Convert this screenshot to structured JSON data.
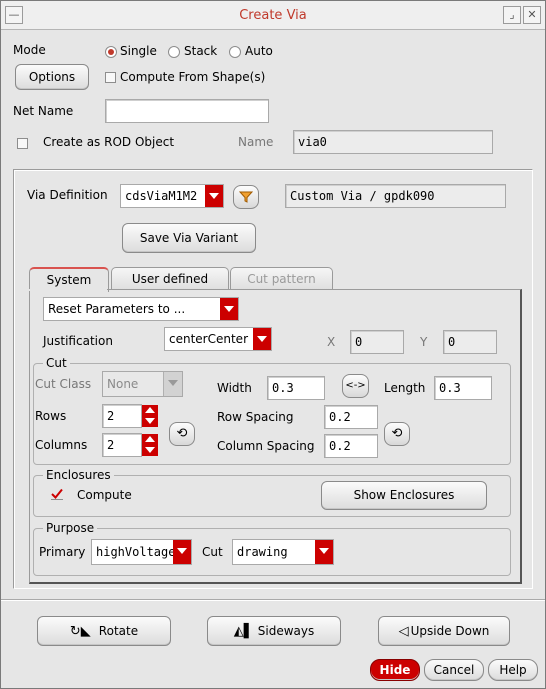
{
  "window": {
    "title": "Create Via"
  },
  "mode": {
    "label": "Mode",
    "options": [
      "Single",
      "Stack",
      "Auto"
    ],
    "selected": "Single"
  },
  "options_button": "Options",
  "compute_from_shapes": "Compute From Shape(s)",
  "net_name": {
    "label": "Net Name",
    "value": ""
  },
  "rod": {
    "label": "Create as ROD Object",
    "name_label": "Name",
    "name_value": "via0"
  },
  "via_definition": {
    "label": "Via Definition",
    "value": "cdsViaM1M2",
    "info": "Custom Via / gpdk090"
  },
  "save_variant_button": "Save Via Variant",
  "tabs": [
    {
      "label": "System",
      "active": true
    },
    {
      "label": "User defined",
      "active": false
    },
    {
      "label": "Cut pattern",
      "disabled": true
    }
  ],
  "reset_params": "Reset Parameters to ...",
  "justification": {
    "label": "Justification",
    "value": "centerCenter"
  },
  "offset": {
    "x_label": "X",
    "x_value": "0",
    "y_label": "Y",
    "y_value": "0"
  },
  "cut": {
    "title": "Cut",
    "class_label": "Cut Class",
    "class_value": "None",
    "width_label": "Width",
    "width_value": "0.3",
    "link_symbol": "<->",
    "length_label": "Length",
    "length_value": "0.3",
    "rows_label": "Rows",
    "rows_value": "2",
    "columns_label": "Columns",
    "columns_value": "2",
    "row_spacing_label": "Row Spacing",
    "row_spacing_value": "0.2",
    "column_spacing_label": "Column Spacing",
    "column_spacing_value": "0.2"
  },
  "enclosures": {
    "title": "Enclosures",
    "compute_label": "Compute",
    "show_button": "Show Enclosures"
  },
  "purpose": {
    "title": "Purpose",
    "primary_label": "Primary",
    "primary_value": "highVoltage",
    "cut_label": "Cut",
    "cut_value": "drawing"
  },
  "bottom": {
    "rotate": "Rotate",
    "sideways": "Sideways",
    "upside_down": "Upside Down"
  },
  "footer": {
    "hide": "Hide",
    "cancel": "Cancel",
    "help": "Help"
  },
  "colors": {
    "accent": "#c00000",
    "title": "#c0392b"
  }
}
